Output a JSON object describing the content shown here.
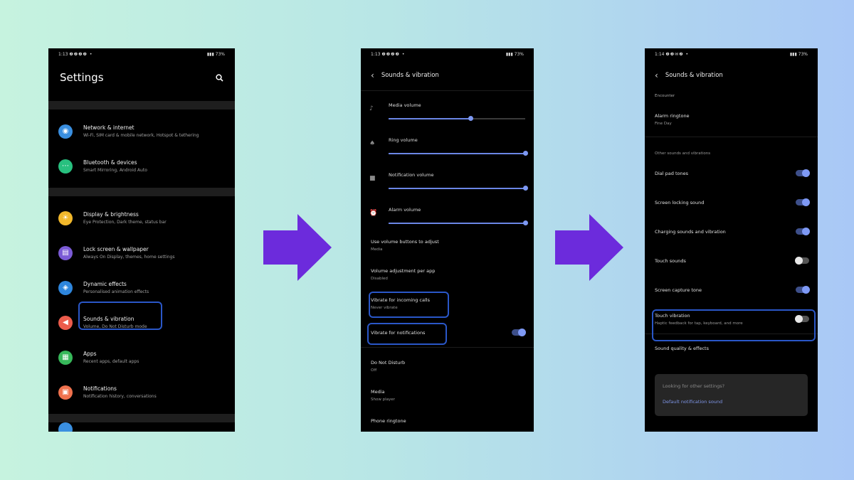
{
  "colors": {
    "accent_arrow": "#6c2bdc",
    "annotation": "#2a57c8",
    "toggle_on": "#7e99f5"
  },
  "phone1": {
    "status": {
      "time": "1:13",
      "left_icons": "❷❷❷❷ •",
      "battery": "73%"
    },
    "title": "Settings",
    "groups": [
      [
        {
          "title": "Network & internet",
          "subtitle": "Wi-Fi, SIM card & mobile network, Hotspot & tethering",
          "icon": "wifi-icon",
          "color": "#3a8fe0",
          "glyph": "◉"
        },
        {
          "title": "Bluetooth & devices",
          "subtitle": "Smart Mirroring, Android Auto",
          "icon": "bluetooth-icon",
          "color": "#28c07f",
          "glyph": "⋯"
        }
      ],
      [
        {
          "title": "Display & brightness",
          "subtitle": "Eye Protection, Dark theme, status bar",
          "icon": "brightness-icon",
          "color": "#f2b82b",
          "glyph": "☀"
        },
        {
          "title": "Lock screen & wallpaper",
          "subtitle": "Always On Display, themes, home settings",
          "icon": "wallpaper-icon",
          "color": "#7b5bd6",
          "glyph": "▤"
        },
        {
          "title": "Dynamic effects",
          "subtitle": "Personalised animation effects",
          "icon": "layers-icon",
          "color": "#2e86dd",
          "glyph": "◈"
        },
        {
          "title": "Sounds & vibration",
          "subtitle": "Volume, Do Not Disturb mode",
          "icon": "sound-icon",
          "color": "#ec5c4c",
          "glyph": "◀"
        },
        {
          "title": "Apps",
          "subtitle": "Recent apps, default apps",
          "icon": "apps-icon",
          "color": "#37b85a",
          "glyph": "▦"
        },
        {
          "title": "Notifications",
          "subtitle": "Notification history, conversations",
          "icon": "notification-icon",
          "color": "#f0724e",
          "glyph": "▣"
        }
      ]
    ]
  },
  "phone2": {
    "status": {
      "time": "1:13",
      "left_icons": "❷❷❷❷ •",
      "battery": "73%"
    },
    "title": "Sounds & vibration",
    "volumes": [
      {
        "label": "Media volume",
        "icon": "music-note-icon",
        "glyph": "♪",
        "level": 0.6
      },
      {
        "label": "Ring volume",
        "icon": "bell-icon",
        "glyph": "♠",
        "level": 1.0
      },
      {
        "label": "Notification volume",
        "icon": "notification-volume-icon",
        "glyph": "■",
        "level": 1.0
      },
      {
        "label": "Alarm volume",
        "icon": "alarm-icon",
        "glyph": "⏰",
        "level": 1.0
      }
    ],
    "settings": [
      {
        "title": "Use volume buttons to adjust",
        "subtitle": "Media"
      },
      {
        "title": "Volume adjustment per app",
        "subtitle": "Disabled"
      },
      {
        "title": "Vibrate for incoming calls",
        "subtitle": "Never vibrate"
      },
      {
        "title": "Vibrate for notifications",
        "toggle": true
      }
    ],
    "more": [
      {
        "title": "Do Not Disturb",
        "subtitle": "Off"
      },
      {
        "title": "Media",
        "subtitle": "Show player"
      },
      {
        "title": "Phone ringtone"
      }
    ]
  },
  "phone3": {
    "status": {
      "time": "1:14",
      "left_icons": "❷❷✉❷ •",
      "battery": "73%"
    },
    "title": "Sounds & vibration",
    "top_partial": "Encounter",
    "alarm": {
      "title": "Alarm ringtone",
      "subtitle": "Fine Day"
    },
    "section_heading": "Other sounds and vibrations",
    "toggles": [
      {
        "title": "Dial pad tones",
        "on": true
      },
      {
        "title": "Screen locking sound",
        "on": true
      },
      {
        "title": "Charging sounds and vibration",
        "on": true
      },
      {
        "title": "Touch sounds",
        "on": false
      },
      {
        "title": "Screen capture tone",
        "on": true
      },
      {
        "title": "Touch vibration",
        "subtitle": "Haptic feedback for tap, keyboard, and more",
        "on": false
      }
    ],
    "quality": "Sound quality & effects",
    "card": {
      "title": "Looking for other settings?",
      "link": "Default notification sound"
    }
  }
}
